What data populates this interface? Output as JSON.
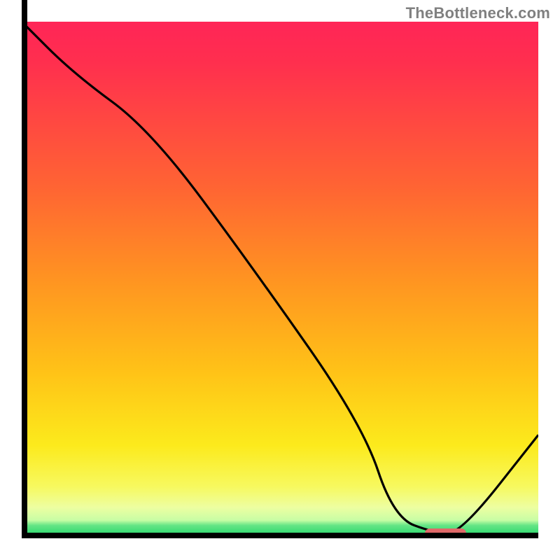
{
  "attribution": "TheBottleneck.com",
  "colors": {
    "gradient": {
      "g0": "#ff2557",
      "g1": "#ff2f4e",
      "g2": "#ff6433",
      "g3": "#ff9421",
      "g4": "#ffc317",
      "g5": "#fcea1c",
      "g6": "#f7f95f",
      "g7": "#edfea1",
      "g8": "#c8fda5",
      "g9": "#65e585",
      "g10": "#19d266"
    },
    "marker": "#e06969",
    "curve": "#000000"
  },
  "chart_data": {
    "type": "line",
    "title": "",
    "xlabel": "",
    "ylabel": "",
    "xlim": [
      0,
      100
    ],
    "ylim": [
      0,
      100
    ],
    "series": [
      {
        "name": "curve",
        "x": [
          0,
          10,
          25,
          45,
          66,
          72,
          80,
          85,
          100
        ],
        "y": [
          100,
          90,
          79,
          52,
          22,
          4,
          1,
          1,
          20
        ]
      }
    ],
    "marker": {
      "x_start": 78,
      "x_end": 86,
      "y": 1
    }
  }
}
